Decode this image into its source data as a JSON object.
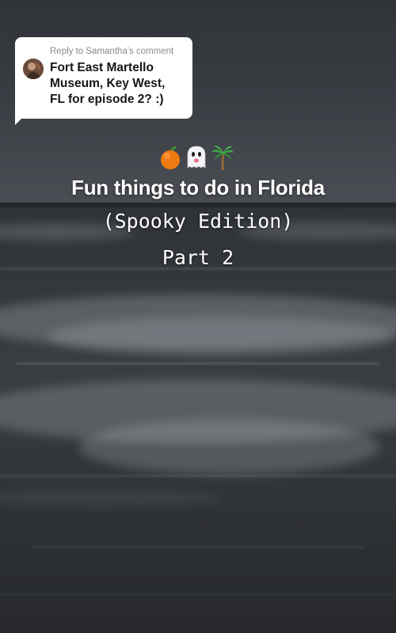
{
  "reply_bubble": {
    "header": "Reply to Samantha's comment",
    "comment_lines": [
      "Fort East Martello",
      "Museum, Key West,",
      "FL for episode 2? :)"
    ]
  },
  "emojis": [
    "tangerine-icon",
    "ghost-icon",
    "palm-tree-icon"
  ],
  "caption": {
    "title": "Fun things to do in Florida",
    "subtitle": "(Spooky Edition)",
    "part": "Part 2"
  },
  "colors": {
    "bubble_background": "#ffffff",
    "caption_text": "#ffffff",
    "sky": "#3a3d42",
    "sea": "#303337"
  }
}
